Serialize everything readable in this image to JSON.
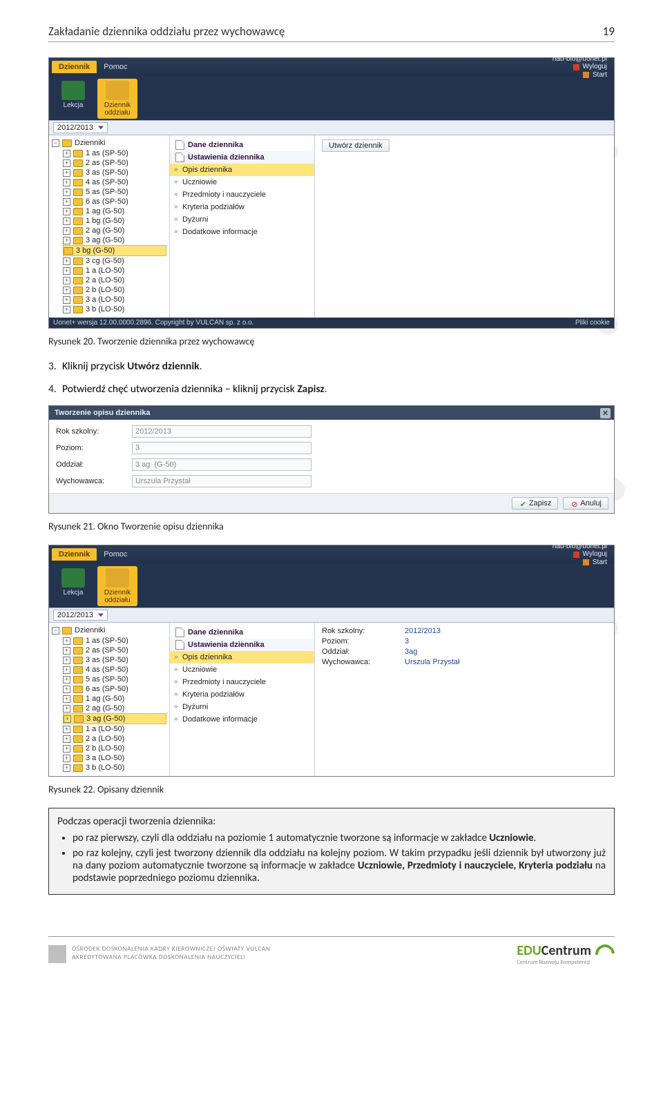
{
  "page": {
    "number": "19",
    "title": "Zakładanie dziennika oddziału przez wychowawcę"
  },
  "app": {
    "tabs": {
      "dziennik": "Dziennik",
      "pomoc": "Pomoc"
    },
    "user_domain": "nau-bio@uonet.pl",
    "logout": "Wyloguj",
    "start": "Start",
    "ribbon": {
      "lekcja": "Lekcja",
      "dziennik_oddzialu": "Dziennik oddziału"
    },
    "year": "2012/2013",
    "tree_root": "Dzienniki",
    "tree_items": [
      "1 as (SP-50)",
      "2 as (SP-50)",
      "3 as (SP-50)",
      "4 as (SP-50)",
      "5 as (SP-50)",
      "6 as (SP-50)",
      "1 ag (G-50)",
      "1 bg (G-50)",
      "2 ag (G-50)",
      "3 ag (G-50)",
      "3 bg (G-50)",
      "3 cg (G-50)",
      "1 a (LO-50)",
      "2 a (LO-50)",
      "2 b (LO-50)",
      "3 a (LO-50)",
      "3 b (LO-50)"
    ],
    "tree_selected_1": "3 bg (G-50)",
    "tree_selected_2": "3 ag (G-50)",
    "section_dane": "Dane dziennika",
    "section_ustawienia": "Ustawienia dziennika",
    "menu": [
      "Opis dziennika",
      "Uczniowie",
      "Przedmioty i nauczyciele",
      "Kryteria podziałów",
      "Dyżurni",
      "Dodatkowe informacje"
    ],
    "utworz": "Utwórz dziennik",
    "status_left": "Uonet+ wersja 12.00.0000.2896. Copyright by VULCAN sp. z o.o.",
    "status_right": "Pliki cookie"
  },
  "shot2_fields": {
    "rok": {
      "label": "Rok szkolny:",
      "value": "2012/2013"
    },
    "poziom": {
      "label": "Poziom:",
      "value": "3"
    },
    "oddzial": {
      "label": "Oddział:",
      "value": "3ag"
    },
    "wych": {
      "label": "Wychowawca:",
      "value": "Urszula Przystał"
    }
  },
  "dialog": {
    "title": "Tworzenie opisu dziennika",
    "rok": {
      "label": "Rok szkolny:",
      "value": "2012/2013"
    },
    "poziom": {
      "label": "Poziom:",
      "value": "3"
    },
    "oddzial": {
      "label": "Oddział:",
      "value": "3 ag  (G-50)"
    },
    "wych": {
      "label": "Wychowawca:",
      "value": "Urszula Przystał"
    },
    "save": "Zapisz",
    "cancel": "Anuluj"
  },
  "captions": {
    "fig20": "Rysunek 20.  Tworzenie dziennika przez wychowawcę",
    "fig21": "Rysunek 21.  Okno Tworzenie opisu dziennika",
    "fig22": "Rysunek 22.  Opisany dziennik"
  },
  "steps": {
    "s3_num": "3.",
    "s3_a": "Kliknij przycisk ",
    "s3_b": "Utwórz dziennik",
    "s3_c": ".",
    "s4_num": "4.",
    "s4_a": "Potwierdź chęć utworzenia dziennika – kliknij przycisk ",
    "s4_b": "Zapisz",
    "s4_c": "."
  },
  "note": {
    "intro": "Podczas operacji tworzenia dziennika:",
    "b1a": "po raz pierwszy, czyli dla oddziału na poziomie 1 automatycznie tworzone są informacje w zakładce ",
    "b1b": "Uczniowie",
    "b1c": ".",
    "b2a": "po raz kolejny, czyli jest tworzony dziennik dla oddziału na kolejny poziom. W takim przypadku jeśli dziennik był utworzony już na dany poziom automatycznie tworzone są informacje w zakładce ",
    "b2b": "Uczniowie, Przedmioty i nauczyciele, Kryteria podziału",
    "b2c": " na podstawie poprzedniego poziomu dziennika."
  },
  "footer": {
    "l1": "OŚRODEK DOSKONALENIA KADRY KIEROWNICZEJ OŚWIATY VULCAN",
    "l2": "AKREDYTOWANA PLACÓWKA DOSKONALENIA NAUCZYCIELI",
    "brand_a": "EDU",
    "brand_b": "Centrum",
    "sub": "Centrum Rozwoju Kompetencji"
  }
}
